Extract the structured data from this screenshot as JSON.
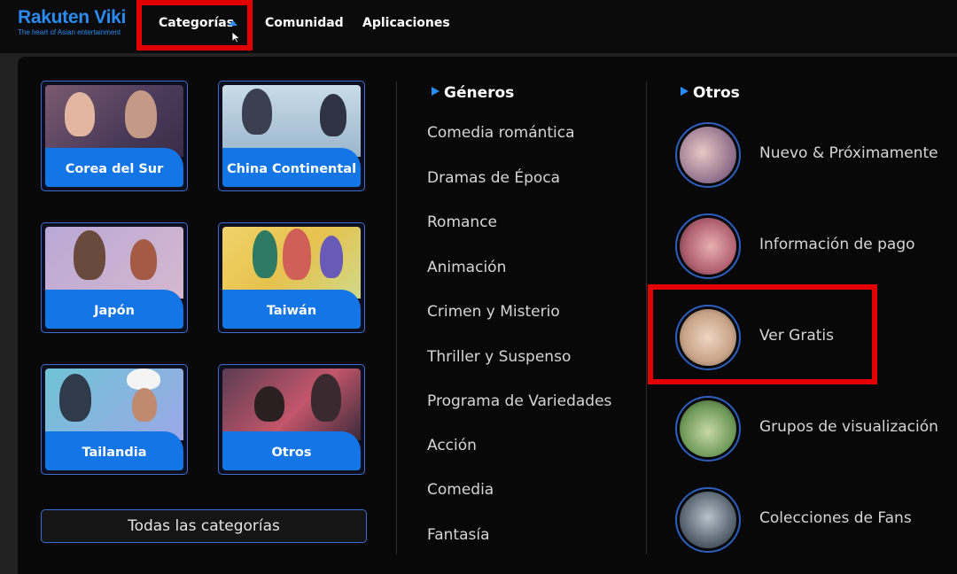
{
  "header": {
    "brand": "Rakuten Viki",
    "tagline": "The heart of Asian entertainment",
    "nav": [
      {
        "label": "Categorías",
        "active": true
      },
      {
        "label": "Comunidad"
      },
      {
        "label": "Aplicaciones"
      }
    ]
  },
  "regions": [
    {
      "label": "Corea del Sur",
      "icon": "poster-image"
    },
    {
      "label": "China Continental",
      "icon": "poster-image"
    },
    {
      "label": "Japón",
      "icon": "poster-image"
    },
    {
      "label": "Taiwán",
      "icon": "poster-image"
    },
    {
      "label": "Tailandia",
      "icon": "poster-image"
    },
    {
      "label": "Otros",
      "icon": "poster-image"
    }
  ],
  "all_categories_label": "Todas las categorías",
  "genres": {
    "title": "Géneros",
    "items": [
      "Comedia romántica",
      "Dramas de Época",
      "Romance",
      "Animación",
      "Crimen y Misterio",
      "Thriller y Suspenso",
      "Programa de Variedades",
      "Acción",
      "Comedia",
      "Fantasía"
    ]
  },
  "others": {
    "title": "Otros",
    "items": [
      "Nuevo & Próximamente",
      "Información de pago",
      "Ver Gratis",
      "Grupos de visualización",
      "Colecciones de Fans"
    ]
  },
  "colors": {
    "accent": "#2a8cf2",
    "highlight": "#e30000",
    "label_bar": "#1476e6"
  }
}
